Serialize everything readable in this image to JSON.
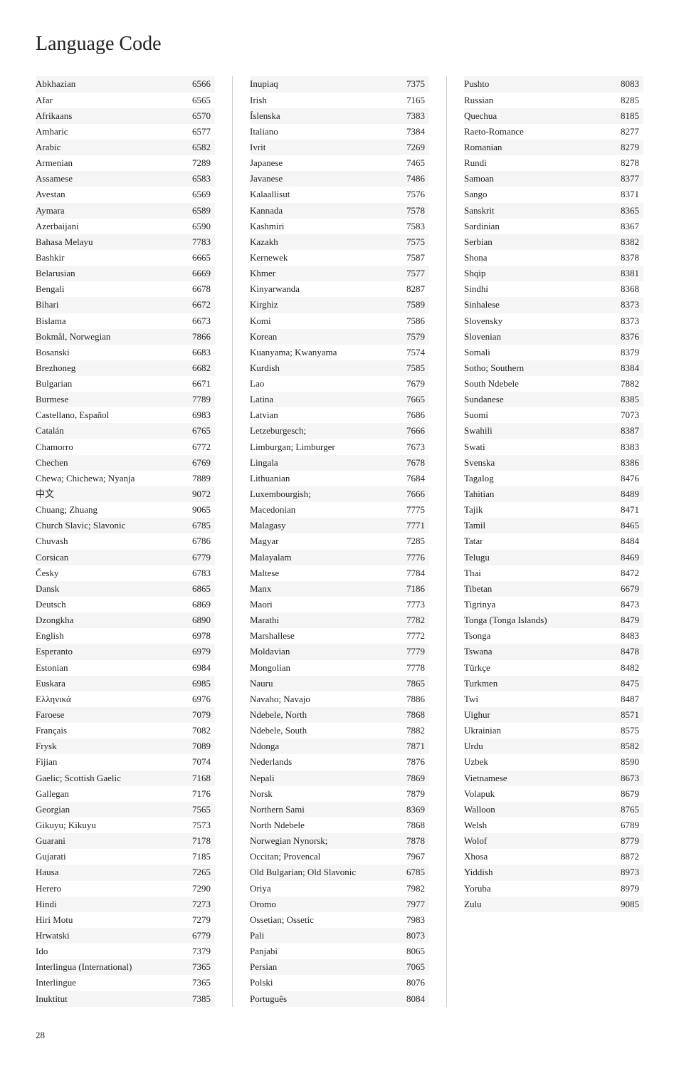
{
  "title": "Language Code",
  "page_number": "28",
  "columns": [
    {
      "id": "col1",
      "entries": [
        {
          "name": "Abkhazian",
          "code": "6566"
        },
        {
          "name": "Afar",
          "code": "6565"
        },
        {
          "name": "Afrikaans",
          "code": "6570"
        },
        {
          "name": "Amharic",
          "code": "6577"
        },
        {
          "name": "Arabic",
          "code": "6582"
        },
        {
          "name": "Armenian",
          "code": "7289"
        },
        {
          "name": "Assamese",
          "code": "6583"
        },
        {
          "name": "Avestan",
          "code": "6569"
        },
        {
          "name": "Aymara",
          "code": "6589"
        },
        {
          "name": "Azerbaijani",
          "code": "6590"
        },
        {
          "name": "Bahasa Melayu",
          "code": "7783"
        },
        {
          "name": "Bashkir",
          "code": "6665"
        },
        {
          "name": "Belarusian",
          "code": "6669"
        },
        {
          "name": "Bengali",
          "code": "6678"
        },
        {
          "name": "Bihari",
          "code": "6672"
        },
        {
          "name": "Bislama",
          "code": "6673"
        },
        {
          "name": "Bokmål, Norwegian",
          "code": "7866"
        },
        {
          "name": "Bosanski",
          "code": "6683"
        },
        {
          "name": "Brezhoneg",
          "code": "6682"
        },
        {
          "name": "Bulgarian",
          "code": "6671"
        },
        {
          "name": "Burmese",
          "code": "7789"
        },
        {
          "name": "Castellano, Español",
          "code": "6983"
        },
        {
          "name": "Catalán",
          "code": "6765"
        },
        {
          "name": "Chamorro",
          "code": "6772"
        },
        {
          "name": "Chechen",
          "code": "6769"
        },
        {
          "name": "Chewa; Chichewa; Nyanja",
          "code": "7889"
        },
        {
          "name": "中文",
          "code": "9072"
        },
        {
          "name": "Chuang; Zhuang",
          "code": "9065"
        },
        {
          "name": "Church Slavic; Slavonic",
          "code": "6785"
        },
        {
          "name": "Chuvash",
          "code": "6786"
        },
        {
          "name": "Corsican",
          "code": "6779"
        },
        {
          "name": "Česky",
          "code": "6783"
        },
        {
          "name": "Dansk",
          "code": "6865"
        },
        {
          "name": "Deutsch",
          "code": "6869"
        },
        {
          "name": "Dzongkha",
          "code": "6890"
        },
        {
          "name": "English",
          "code": "6978"
        },
        {
          "name": "Esperanto",
          "code": "6979"
        },
        {
          "name": "Estonian",
          "code": "6984"
        },
        {
          "name": "Euskara",
          "code": "6985"
        },
        {
          "name": "Ελληνικά",
          "code": "6976"
        },
        {
          "name": "Faroese",
          "code": "7079"
        },
        {
          "name": "Français",
          "code": "7082"
        },
        {
          "name": "Frysk",
          "code": "7089"
        },
        {
          "name": "Fijian",
          "code": "7074"
        },
        {
          "name": "Gaelic; Scottish Gaelic",
          "code": "7168"
        },
        {
          "name": "Gallegan",
          "code": "7176"
        },
        {
          "name": "Georgian",
          "code": "7565"
        },
        {
          "name": "Gikuyu; Kikuyu",
          "code": "7573"
        },
        {
          "name": "Guarani",
          "code": "7178"
        },
        {
          "name": "Gujarati",
          "code": "7185"
        },
        {
          "name": "Hausa",
          "code": "7265"
        },
        {
          "name": "Herero",
          "code": "7290"
        },
        {
          "name": "Hindi",
          "code": "7273"
        },
        {
          "name": "Hiri Motu",
          "code": "7279"
        },
        {
          "name": "Hrwatski",
          "code": "6779"
        },
        {
          "name": "Ido",
          "code": "7379"
        },
        {
          "name": "Interlingua (International)",
          "code": "7365"
        },
        {
          "name": "Interlingue",
          "code": "7365"
        },
        {
          "name": "Inuktitut",
          "code": "7385"
        }
      ]
    },
    {
      "id": "col2",
      "entries": [
        {
          "name": "Inupiaq",
          "code": "7375"
        },
        {
          "name": "Irish",
          "code": "7165"
        },
        {
          "name": "Íslenska",
          "code": "7383"
        },
        {
          "name": "Italiano",
          "code": "7384"
        },
        {
          "name": "Ivrit",
          "code": "7269"
        },
        {
          "name": "Japanese",
          "code": "7465"
        },
        {
          "name": "Javanese",
          "code": "7486"
        },
        {
          "name": "Kalaallisut",
          "code": "7576"
        },
        {
          "name": "Kannada",
          "code": "7578"
        },
        {
          "name": "Kashmiri",
          "code": "7583"
        },
        {
          "name": "Kazakh",
          "code": "7575"
        },
        {
          "name": "Kernewek",
          "code": "7587"
        },
        {
          "name": "Khmer",
          "code": "7577"
        },
        {
          "name": "Kinyarwanda",
          "code": "8287"
        },
        {
          "name": "Kirghiz",
          "code": "7589"
        },
        {
          "name": "Komi",
          "code": "7586"
        },
        {
          "name": "Korean",
          "code": "7579"
        },
        {
          "name": "Kuanyama; Kwanyama",
          "code": "7574"
        },
        {
          "name": "Kurdish",
          "code": "7585"
        },
        {
          "name": "Lao",
          "code": "7679"
        },
        {
          "name": "Latina",
          "code": "7665"
        },
        {
          "name": "Latvian",
          "code": "7686"
        },
        {
          "name": "Letzeburgesch;",
          "code": "7666"
        },
        {
          "name": "Limburgan; Limburger",
          "code": "7673"
        },
        {
          "name": "Lingala",
          "code": "7678"
        },
        {
          "name": "Lithuanian",
          "code": "7684"
        },
        {
          "name": "Luxembourgish;",
          "code": "7666"
        },
        {
          "name": "Macedonian",
          "code": "7775"
        },
        {
          "name": "Malagasy",
          "code": "7771"
        },
        {
          "name": "Magyar",
          "code": "7285"
        },
        {
          "name": "Malayalam",
          "code": "7776"
        },
        {
          "name": "Maltese",
          "code": "7784"
        },
        {
          "name": "Manx",
          "code": "7186"
        },
        {
          "name": "Maori",
          "code": "7773"
        },
        {
          "name": "Marathi",
          "code": "7782"
        },
        {
          "name": "Marshallese",
          "code": "7772"
        },
        {
          "name": "Moldavian",
          "code": "7779"
        },
        {
          "name": "Mongolian",
          "code": "7778"
        },
        {
          "name": "Nauru",
          "code": "7865"
        },
        {
          "name": "Navaho; Navajo",
          "code": "7886"
        },
        {
          "name": "Ndebele, North",
          "code": "7868"
        },
        {
          "name": "Ndebele, South",
          "code": "7882"
        },
        {
          "name": "Ndonga",
          "code": "7871"
        },
        {
          "name": "Nederlands",
          "code": "7876"
        },
        {
          "name": "Nepali",
          "code": "7869"
        },
        {
          "name": "Norsk",
          "code": "7879"
        },
        {
          "name": "Northern Sami",
          "code": "8369"
        },
        {
          "name": "North Ndebele",
          "code": "7868"
        },
        {
          "name": "Norwegian Nynorsk;",
          "code": "7878"
        },
        {
          "name": "Occitan; Provencal",
          "code": "7967"
        },
        {
          "name": "Old Bulgarian; Old Slavonic",
          "code": "6785"
        },
        {
          "name": "Oriya",
          "code": "7982"
        },
        {
          "name": "Oromo",
          "code": "7977"
        },
        {
          "name": "Ossetian; Ossetic",
          "code": "7983"
        },
        {
          "name": "Pali",
          "code": "8073"
        },
        {
          "name": "Panjabi",
          "code": "8065"
        },
        {
          "name": "Persian",
          "code": "7065"
        },
        {
          "name": "Polski",
          "code": "8076"
        },
        {
          "name": "Português",
          "code": "8084"
        }
      ]
    },
    {
      "id": "col3",
      "entries": [
        {
          "name": "Pushto",
          "code": "8083"
        },
        {
          "name": "Russian",
          "code": "8285"
        },
        {
          "name": "Quechua",
          "code": "8185"
        },
        {
          "name": "Raeto-Romance",
          "code": "8277"
        },
        {
          "name": "Romanian",
          "code": "8279"
        },
        {
          "name": "Rundi",
          "code": "8278"
        },
        {
          "name": "Samoan",
          "code": "8377"
        },
        {
          "name": "Sango",
          "code": "8371"
        },
        {
          "name": "Sanskrit",
          "code": "8365"
        },
        {
          "name": "Sardinian",
          "code": "8367"
        },
        {
          "name": "Serbian",
          "code": "8382"
        },
        {
          "name": "Shona",
          "code": "8378"
        },
        {
          "name": "Shqip",
          "code": "8381"
        },
        {
          "name": "Sindhi",
          "code": "8368"
        },
        {
          "name": "Sinhalese",
          "code": "8373"
        },
        {
          "name": "Slovensky",
          "code": "8373"
        },
        {
          "name": "Slovenian",
          "code": "8376"
        },
        {
          "name": "Somali",
          "code": "8379"
        },
        {
          "name": "Sotho; Southern",
          "code": "8384"
        },
        {
          "name": "South Ndebele",
          "code": "7882"
        },
        {
          "name": "Sundanese",
          "code": "8385"
        },
        {
          "name": "Suomi",
          "code": "7073"
        },
        {
          "name": "Swahili",
          "code": "8387"
        },
        {
          "name": "Swati",
          "code": "8383"
        },
        {
          "name": "Svenska",
          "code": "8386"
        },
        {
          "name": "Tagalog",
          "code": "8476"
        },
        {
          "name": "Tahitian",
          "code": "8489"
        },
        {
          "name": "Tajik",
          "code": "8471"
        },
        {
          "name": "Tamil",
          "code": "8465"
        },
        {
          "name": "Tatar",
          "code": "8484"
        },
        {
          "name": "Telugu",
          "code": "8469"
        },
        {
          "name": "Thai",
          "code": "8472"
        },
        {
          "name": "Tibetan",
          "code": "6679"
        },
        {
          "name": "Tigrinya",
          "code": "8473"
        },
        {
          "name": "Tonga (Tonga Islands)",
          "code": "8479"
        },
        {
          "name": "Tsonga",
          "code": "8483"
        },
        {
          "name": "Tswana",
          "code": "8478"
        },
        {
          "name": "Türkçe",
          "code": "8482"
        },
        {
          "name": "Turkmen",
          "code": "8475"
        },
        {
          "name": "Twi",
          "code": "8487"
        },
        {
          "name": "Uighur",
          "code": "8571"
        },
        {
          "name": "Ukrainian",
          "code": "8575"
        },
        {
          "name": "Urdu",
          "code": "8582"
        },
        {
          "name": "Uzbek",
          "code": "8590"
        },
        {
          "name": "Vietnamese",
          "code": "8673"
        },
        {
          "name": "Volapuk",
          "code": "8679"
        },
        {
          "name": "Walloon",
          "code": "8765"
        },
        {
          "name": "Welsh",
          "code": "6789"
        },
        {
          "name": "Wolof",
          "code": "8779"
        },
        {
          "name": "Xhosa",
          "code": "8872"
        },
        {
          "name": "Yiddish",
          "code": "8973"
        },
        {
          "name": "Yoruba",
          "code": "8979"
        },
        {
          "name": "Zulu",
          "code": "9085"
        }
      ]
    }
  ]
}
